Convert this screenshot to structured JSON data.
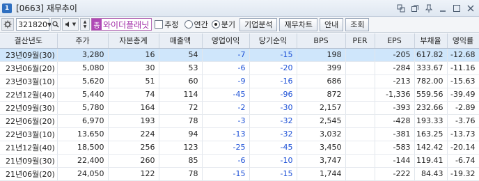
{
  "window": {
    "icon_text": "1",
    "title": "[0663] 재무추이"
  },
  "toolbar": {
    "code": "321820",
    "badge": "종",
    "stock_name": "와이더플래닛",
    "checkbox_label": "추정",
    "radio_annual": "연간",
    "radio_quarter": "분기",
    "selected_period": "분기",
    "btn_company": "기업분석",
    "btn_chart": "재무차트",
    "btn_guide": "안내",
    "btn_search": "조회"
  },
  "table": {
    "headers": [
      "결산년도",
      "주가",
      "자본총계",
      "매출액",
      "영업이익",
      "당기순익",
      "BPS",
      "PER",
      "EPS",
      "부채율",
      "영익률"
    ],
    "rows": [
      [
        "23년09월(30)",
        "3,280",
        "16",
        "54",
        "-7",
        "-15",
        "198",
        "",
        "-205",
        "617.82",
        "-12.68"
      ],
      [
        "23년06월(20)",
        "5,080",
        "30",
        "53",
        "-6",
        "-20",
        "399",
        "",
        "-284",
        "333.67",
        "-11.16"
      ],
      [
        "23년03월(10)",
        "5,620",
        "51",
        "60",
        "-9",
        "-16",
        "686",
        "",
        "-213",
        "782.00",
        "-15.63"
      ],
      [
        "22년12월(40)",
        "5,440",
        "74",
        "114",
        "-45",
        "-96",
        "872",
        "",
        "-1,336",
        "559.56",
        "-39.49"
      ],
      [
        "22년09월(30)",
        "5,780",
        "164",
        "72",
        "-2",
        "-30",
        "2,157",
        "",
        "-393",
        "232.66",
        "-2.89"
      ],
      [
        "22년06월(20)",
        "6,970",
        "193",
        "78",
        "-3",
        "-32",
        "2,545",
        "",
        "-428",
        "193.33",
        "-3.76"
      ],
      [
        "22년03월(10)",
        "13,650",
        "224",
        "94",
        "-13",
        "-32",
        "3,032",
        "",
        "-381",
        "163.25",
        "-13.73"
      ],
      [
        "21년12월(40)",
        "18,500",
        "256",
        "123",
        "-25",
        "-45",
        "3,450",
        "",
        "-583",
        "142.42",
        "-20.14"
      ],
      [
        "21년09월(30)",
        "22,400",
        "260",
        "85",
        "-6",
        "-10",
        "3,747",
        "",
        "-144",
        "119.41",
        "-6.74"
      ],
      [
        "21년06월(20)",
        "24,050",
        "122",
        "78",
        "-15",
        "-15",
        "1,744",
        "",
        "-222",
        "84.43",
        "-19.32"
      ]
    ],
    "selected_row": 0
  },
  "colors": {
    "negative": "#1b4fd6",
    "selected_row": "#cfe6fb",
    "header_bg": "#e9eef5",
    "name_accent": "#a02aa6"
  }
}
